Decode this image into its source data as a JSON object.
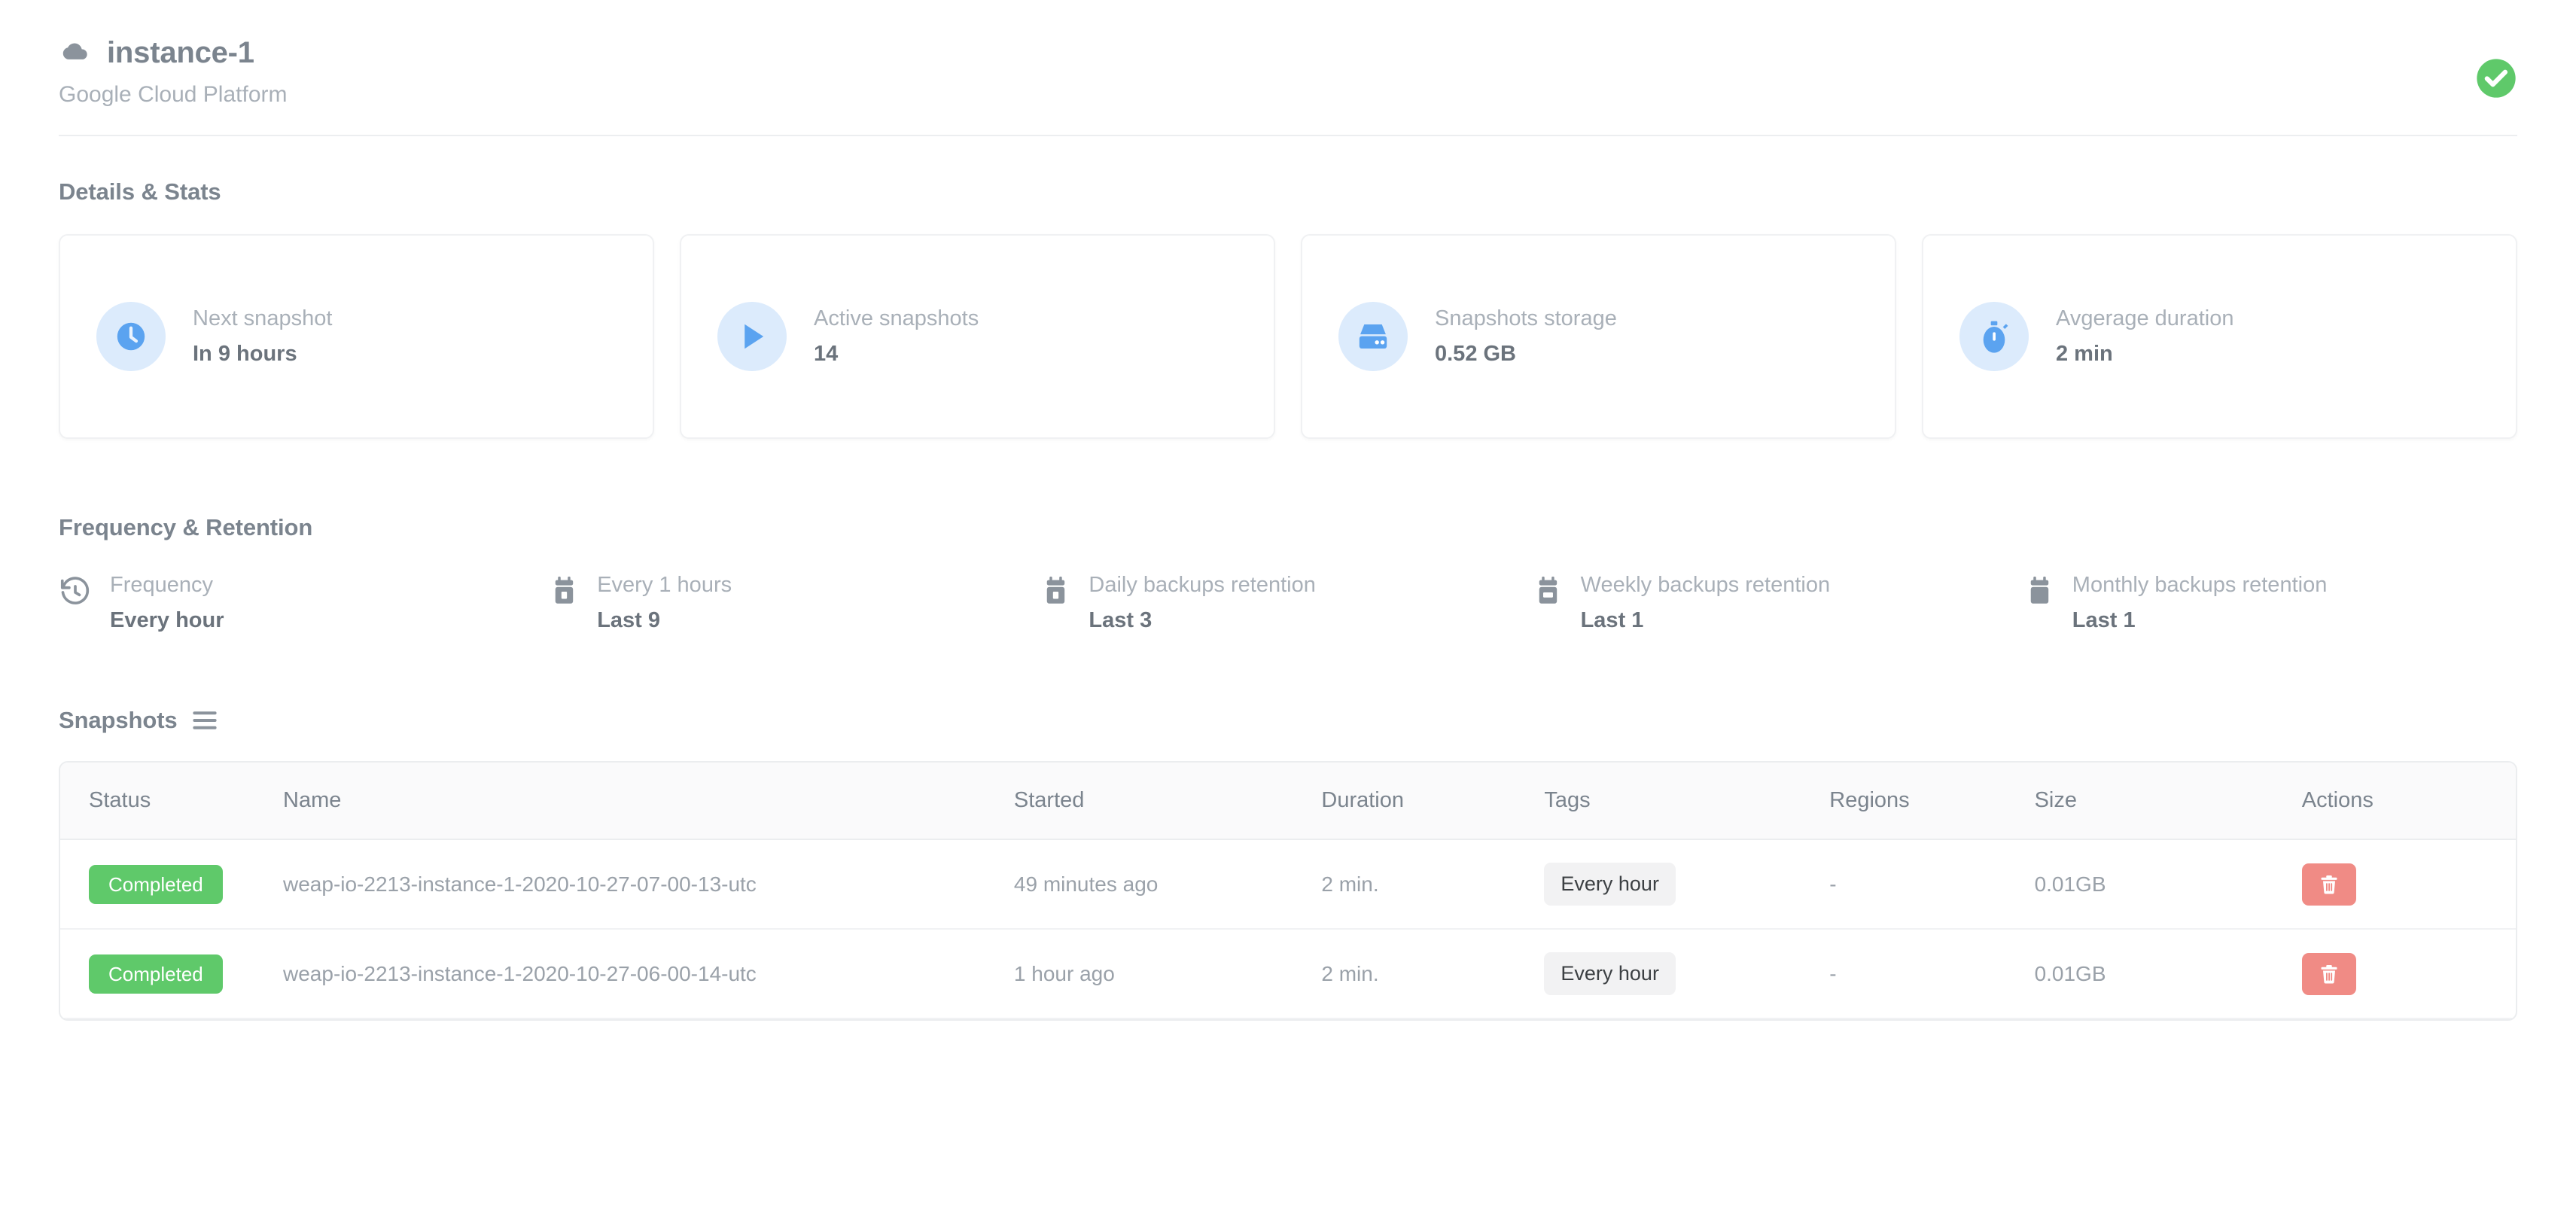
{
  "header": {
    "cloud_icon": "cloud-icon",
    "title": "instance-1",
    "subtitle": "Google Cloud Platform",
    "status_icon": "check-circle-icon",
    "status_color": "#5fc96a"
  },
  "details": {
    "heading": "Details & Stats",
    "cards": [
      {
        "icon": "clock-icon",
        "label": "Next snapshot",
        "value": "In 9 hours"
      },
      {
        "icon": "play-icon",
        "label": "Active snapshots",
        "value": "14"
      },
      {
        "icon": "hard-drive-icon",
        "label": "Snapshots storage",
        "value": "0.52 GB"
      },
      {
        "icon": "stopwatch-icon",
        "label": "Avgerage duration",
        "value": "2 min"
      }
    ],
    "icon_circle_color": "#dcebfc",
    "icon_color": "#5ba3f0"
  },
  "frequency": {
    "heading": "Frequency & Retention",
    "items": [
      {
        "icon": "history-icon",
        "label": "Frequency",
        "value": "Every hour"
      },
      {
        "icon": "calendar-icon",
        "label": "Every 1 hours",
        "value": "Last 9"
      },
      {
        "icon": "calendar-icon",
        "label": "Daily backups retention",
        "value": "Last 3"
      },
      {
        "icon": "calendar-icon",
        "label": "Weekly backups retention",
        "value": "Last 1"
      },
      {
        "icon": "calendar-icon",
        "label": "Monthly backups retention",
        "value": "Last 1"
      }
    ]
  },
  "snapshots": {
    "heading": "Snapshots",
    "menu_icon": "hamburger-icon",
    "columns": [
      "Status",
      "Name",
      "Started",
      "Duration",
      "Tags",
      "Regions",
      "Size",
      "Actions"
    ],
    "rows": [
      {
        "status": "Completed",
        "name": "weap-io-2213-instance-1-2020-10-27-07-00-13-utc",
        "started": "49 minutes ago",
        "duration": "2 min.",
        "tag": "Every hour",
        "region": "-",
        "size": "0.01GB",
        "action_icon": "trash-icon"
      },
      {
        "status": "Completed",
        "name": "weap-io-2213-instance-1-2020-10-27-06-00-14-utc",
        "started": "1 hour ago",
        "duration": "2 min.",
        "tag": "Every hour",
        "region": "-",
        "size": "0.01GB",
        "action_icon": "trash-icon"
      }
    ],
    "badge_color": "#5fc96a",
    "delete_button_color": "#f08b85"
  }
}
